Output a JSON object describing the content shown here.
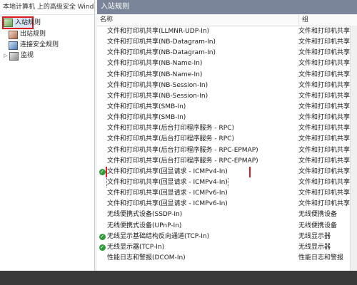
{
  "left": {
    "title": "本地计算机 上的高级安全 Windows",
    "items": [
      {
        "label": "入站规则",
        "selected": true
      },
      {
        "label": "出站规则"
      },
      {
        "label": "连接安全规则"
      },
      {
        "label": "监视"
      }
    ]
  },
  "right": {
    "title": "入站规则",
    "columns": {
      "name": "名称",
      "group": "组"
    },
    "rows": [
      {
        "name": "文件和打印机共享(LLMNR-UDP-In)",
        "group": "文件和打印机共享"
      },
      {
        "name": "文件和打印机共享(NB-Datagram-In)",
        "group": "文件和打印机共享"
      },
      {
        "name": "文件和打印机共享(NB-Datagram-In)",
        "group": "文件和打印机共享"
      },
      {
        "name": "文件和打印机共享(NB-Name-In)",
        "group": "文件和打印机共享"
      },
      {
        "name": "文件和打印机共享(NB-Name-In)",
        "group": "文件和打印机共享"
      },
      {
        "name": "文件和打印机共享(NB-Session-In)",
        "group": "文件和打印机共享"
      },
      {
        "name": "文件和打印机共享(NB-Session-In)",
        "group": "文件和打印机共享"
      },
      {
        "name": "文件和打印机共享(SMB-In)",
        "group": "文件和打印机共享"
      },
      {
        "name": "文件和打印机共享(SMB-In)",
        "group": "文件和打印机共享"
      },
      {
        "name": "文件和打印机共享(后台打印程序服务 - RPC)",
        "group": "文件和打印机共享"
      },
      {
        "name": "文件和打印机共享(后台打印程序服务 - RPC)",
        "group": "文件和打印机共享"
      },
      {
        "name": "文件和打印机共享(后台打印程序服务 - RPC-EPMAP)",
        "group": "文件和打印机共享"
      },
      {
        "name": "文件和打印机共享(后台打印程序服务 - RPC-EPMAP)",
        "group": "文件和打印机共享"
      },
      {
        "name": "文件和打印机共享(回显请求 - ICMPv4-In)",
        "group": "文件和打印机共享",
        "enabled": true,
        "highlighted": true
      },
      {
        "name": "文件和打印机共享(回显请求 - ICMPv4-In)",
        "group": "文件和打印机共享",
        "focused": true
      },
      {
        "name": "文件和打印机共享(回显请求 - ICMPv6-In)",
        "group": "文件和打印机共享"
      },
      {
        "name": "文件和打印机共享(回显请求 - ICMPv6-In)",
        "group": "文件和打印机共享"
      },
      {
        "name": "无线便携式设备(SSDP-In)",
        "group": "无线便携设备"
      },
      {
        "name": "无线便携式设备(UPnP-In)",
        "group": "无线便携设备"
      },
      {
        "name": "无线显示基础结构反向通道(TCP-In)",
        "group": "无线显示器",
        "enabled": true
      },
      {
        "name": "无线显示器(TCP-In)",
        "group": "无线显示器",
        "enabled": true
      },
      {
        "name": "性能日志和警报(DCOM-In)",
        "group": "性能日志和警报"
      }
    ]
  }
}
